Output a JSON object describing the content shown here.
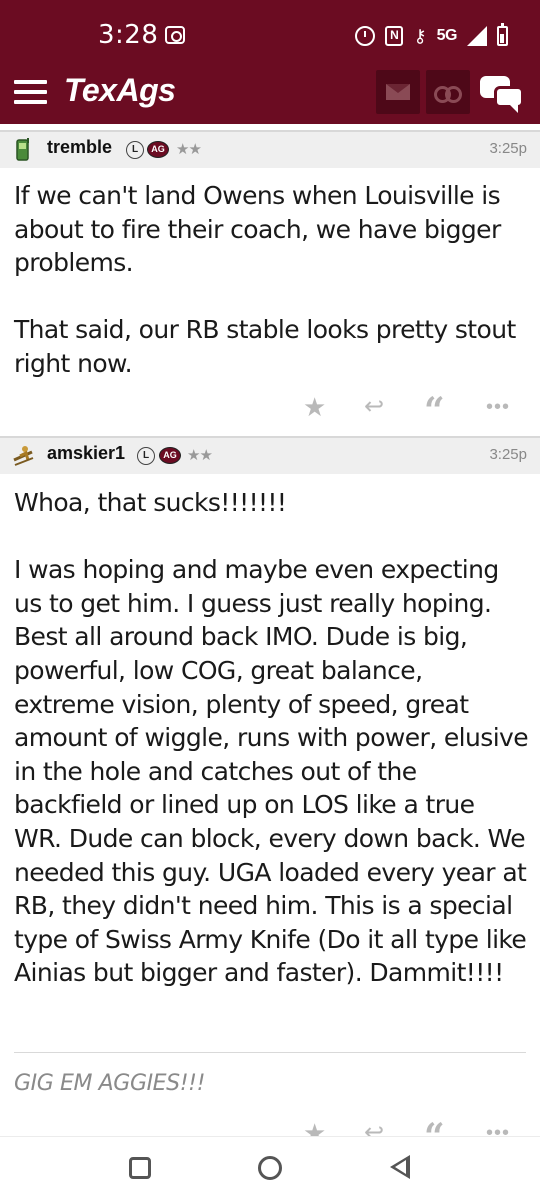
{
  "status_bar": {
    "time": "3:28",
    "network": "5G",
    "icons": [
      "camera-icon",
      "alarm-icon",
      "nfc-icon",
      "key-icon",
      "signal-icon",
      "battery-icon"
    ]
  },
  "app_bar": {
    "logo": "TexAgs",
    "icons": [
      "menu-icon",
      "mail-icon",
      "binoculars-icon",
      "chat-icon"
    ],
    "colors": {
      "header_bg": "#6b0c22",
      "button_bg": "#4e0818"
    }
  },
  "posts": [
    {
      "username": "tremble",
      "badge_l": "L",
      "badge_ag": "AG",
      "stars": "★★",
      "time": "3:25p",
      "avatar": "phone-icon",
      "paragraphs": [
        "If we can't land Owens when Louisville is about to fire their coach, we have bigger problems.",
        "That said, our RB stable looks pretty stout right now."
      ]
    },
    {
      "username": "amskier1",
      "badge_l": "L",
      "badge_ag": "AG",
      "stars": "★★",
      "time": "3:25p",
      "avatar": "skier-icon",
      "paragraphs": [
        "Whoa, that sucks!!!!!!!",
        "I was hoping and maybe even expecting us to get him. I guess just really hoping. Best all around back IMO. Dude is big, powerful, low COG, great balance, extreme vision, plenty of speed, great amount of wiggle, runs with power, elusive in the hole and catches out of the backfield or lined up on LOS like a true WR. Dude can block, every down back. We needed this guy. UGA loaded every year at RB, they didn't need him. This is a special type of Swiss Army Knife (Do it all type like Ainias but bigger and faster). Dammit!!!!"
      ],
      "signature": "GIG EM AGGIES!!!"
    }
  ],
  "post_actions": [
    "star-icon",
    "reply-icon",
    "quote-icon",
    "more-icon"
  ],
  "nav_bar": [
    "recents-icon",
    "home-icon",
    "back-icon"
  ]
}
